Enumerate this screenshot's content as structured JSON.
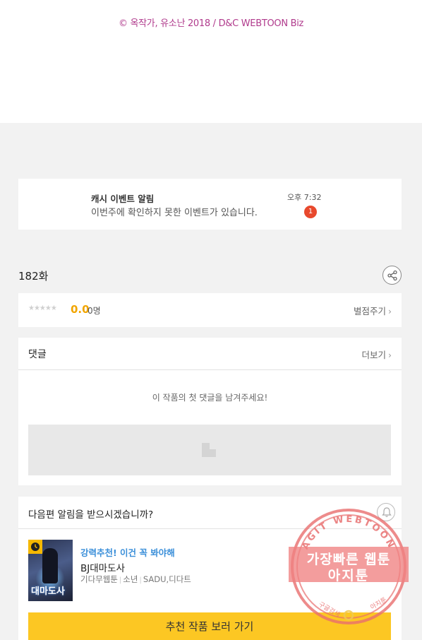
{
  "copyright": "© 옥작가, 유소난 2018 / D&C WEBTOON Biz",
  "notification": {
    "title": "캐시 이벤트 알림",
    "message": "이번주에 확인하지 못한 이벤트가 있습니다.",
    "time": "오후 7:32",
    "badge_count": "1"
  },
  "episode": {
    "title": "182화",
    "share_icon": "share-icon"
  },
  "rating": {
    "stars": "★★★★★",
    "stars_filled": 0,
    "score": "0.0",
    "count": "0명",
    "rate_link": "별점주기"
  },
  "comments": {
    "label": "댓글",
    "more": "더보기",
    "empty_message": "이 작품의 첫 댓글을 남겨주세요!"
  },
  "alarm": {
    "question": "다음편 알림을 받으시겠습니까?",
    "bell_icon": "bell-icon"
  },
  "recommendation": {
    "tag": "강력추천! 이건 꼭 봐야해",
    "title": "BJ대마도사",
    "thumb_title": "대마도사",
    "meta": [
      "기다무웹툰",
      "소년",
      "SADU,디다트"
    ],
    "button": "추천 작품 보러 가기"
  },
  "watermark": {
    "ring_text": "AGIT WEBTOON",
    "line1": "가장빠른 웹툰",
    "line2": "아지툰",
    "bottom_left": "구글검색",
    "bottom_right": "아지툰"
  },
  "colors": {
    "accent_yellow": "#fcc723",
    "score_orange": "#f1a500",
    "badge_red": "#e8492d",
    "link_blue": "#3b8fd9",
    "copyright_magenta": "#b03a8c"
  }
}
